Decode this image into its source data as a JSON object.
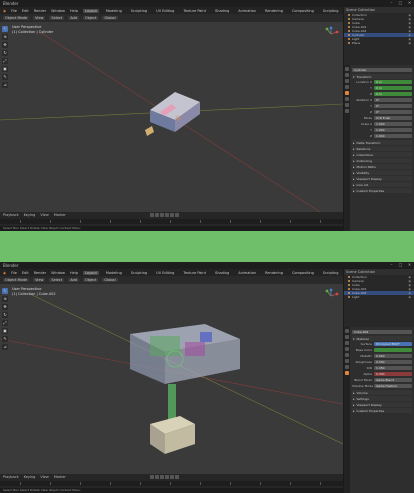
{
  "app": "Blender",
  "colors": {
    "accent": "#4772b3",
    "active_tab": "#e0853c",
    "desktop": "#6fbf6a",
    "field_green": "#3f8a3a"
  },
  "top": {
    "title": "Blender",
    "menu": [
      "File",
      "Edit",
      "Render",
      "Window",
      "Help"
    ],
    "workspaces": [
      "Layout",
      "Modeling",
      "Sculpting",
      "UV Editing",
      "Texture Paint",
      "Shading",
      "Animation",
      "Rendering",
      "Compositing",
      "Scripting"
    ],
    "header": [
      "Object Mode",
      "View",
      "Select",
      "Add",
      "Object",
      "Global"
    ],
    "viewport_info": [
      "User Perspective",
      "(1) Collection | Cylinder"
    ],
    "timeline": [
      "Playback",
      "Keying",
      "View",
      "Marker"
    ],
    "status": "Select   Box Select   Rotate View   Object Context Menu",
    "outliner_title": "Scene Collection",
    "outliner": [
      {
        "label": "Collection",
        "sel": false
      },
      {
        "label": "Camera",
        "sel": false
      },
      {
        "label": "Cube",
        "sel": false
      },
      {
        "label": "Cube.001",
        "sel": false
      },
      {
        "label": "Cube.002",
        "sel": false
      },
      {
        "label": "Cylinder",
        "sel": true
      },
      {
        "label": "Light",
        "sel": false
      },
      {
        "label": "Plane",
        "sel": false
      }
    ],
    "props": {
      "object": "Cylinder",
      "section": "Transform",
      "rows": [
        {
          "label": "Location X",
          "value": "0 m",
          "kind": "green"
        },
        {
          "label": "Y",
          "value": "0 m",
          "kind": "green"
        },
        {
          "label": "Z",
          "value": "0 m",
          "kind": "green"
        },
        {
          "label": "Rotation X",
          "value": "0°",
          "kind": ""
        },
        {
          "label": "Y",
          "value": "0°",
          "kind": ""
        },
        {
          "label": "Z",
          "value": "0°",
          "kind": ""
        },
        {
          "label": "Mode",
          "value": "XYZ Euler",
          "kind": ""
        },
        {
          "label": "Scale X",
          "value": "1.000",
          "kind": ""
        },
        {
          "label": "Y",
          "value": "1.000",
          "kind": ""
        },
        {
          "label": "Z",
          "value": "1.000",
          "kind": ""
        }
      ],
      "sections": [
        "Delta Transform",
        "Relations",
        "Collections",
        "Instancing",
        "Motion Paths",
        "Visibility",
        "Viewport Display",
        "Line Art",
        "Custom Properties"
      ]
    }
  },
  "bottom": {
    "title": "Blender",
    "menu": [
      "File",
      "Edit",
      "Render",
      "Window",
      "Help"
    ],
    "workspaces": [
      "Layout",
      "Modeling",
      "Sculpting",
      "UV Editing",
      "Texture Paint",
      "Shading",
      "Animation",
      "Rendering",
      "Compositing",
      "Scripting"
    ],
    "header": [
      "Object Mode",
      "View",
      "Select",
      "Add",
      "Object",
      "Global"
    ],
    "viewport_info": [
      "User Perspective",
      "(1) Collection | Cube.002"
    ],
    "timeline": [
      "Playback",
      "Keying",
      "View",
      "Marker"
    ],
    "status": "Select   Box Select   Rotate View   Object Context Menu",
    "outliner_title": "Scene Collection",
    "outliner": [
      {
        "label": "Collection",
        "sel": false
      },
      {
        "label": "Camera",
        "sel": false
      },
      {
        "label": "Cube",
        "sel": false
      },
      {
        "label": "Cube.001",
        "sel": false
      },
      {
        "label": "Cube.002",
        "sel": true
      },
      {
        "label": "Light",
        "sel": false
      }
    ],
    "props": {
      "object": "Cube.002",
      "section": "Material",
      "rows": [
        {
          "label": "Surface",
          "value": "Principled BSDF",
          "kind": "blue"
        },
        {
          "label": "Base Color",
          "value": "",
          "kind": "green"
        },
        {
          "label": "Metallic",
          "value": "0.000",
          "kind": ""
        },
        {
          "label": "Roughness",
          "value": "0.500",
          "kind": ""
        },
        {
          "label": "IOR",
          "value": "1.450",
          "kind": ""
        },
        {
          "label": "Alpha",
          "value": "0.300",
          "kind": "red"
        },
        {
          "label": "Blend Mode",
          "value": "Alpha Blend",
          "kind": ""
        },
        {
          "label": "Shadow Mode",
          "value": "Alpha Hashed",
          "kind": ""
        }
      ],
      "sections": [
        "Volume",
        "Settings",
        "Viewport Display",
        "Custom Properties"
      ]
    }
  }
}
